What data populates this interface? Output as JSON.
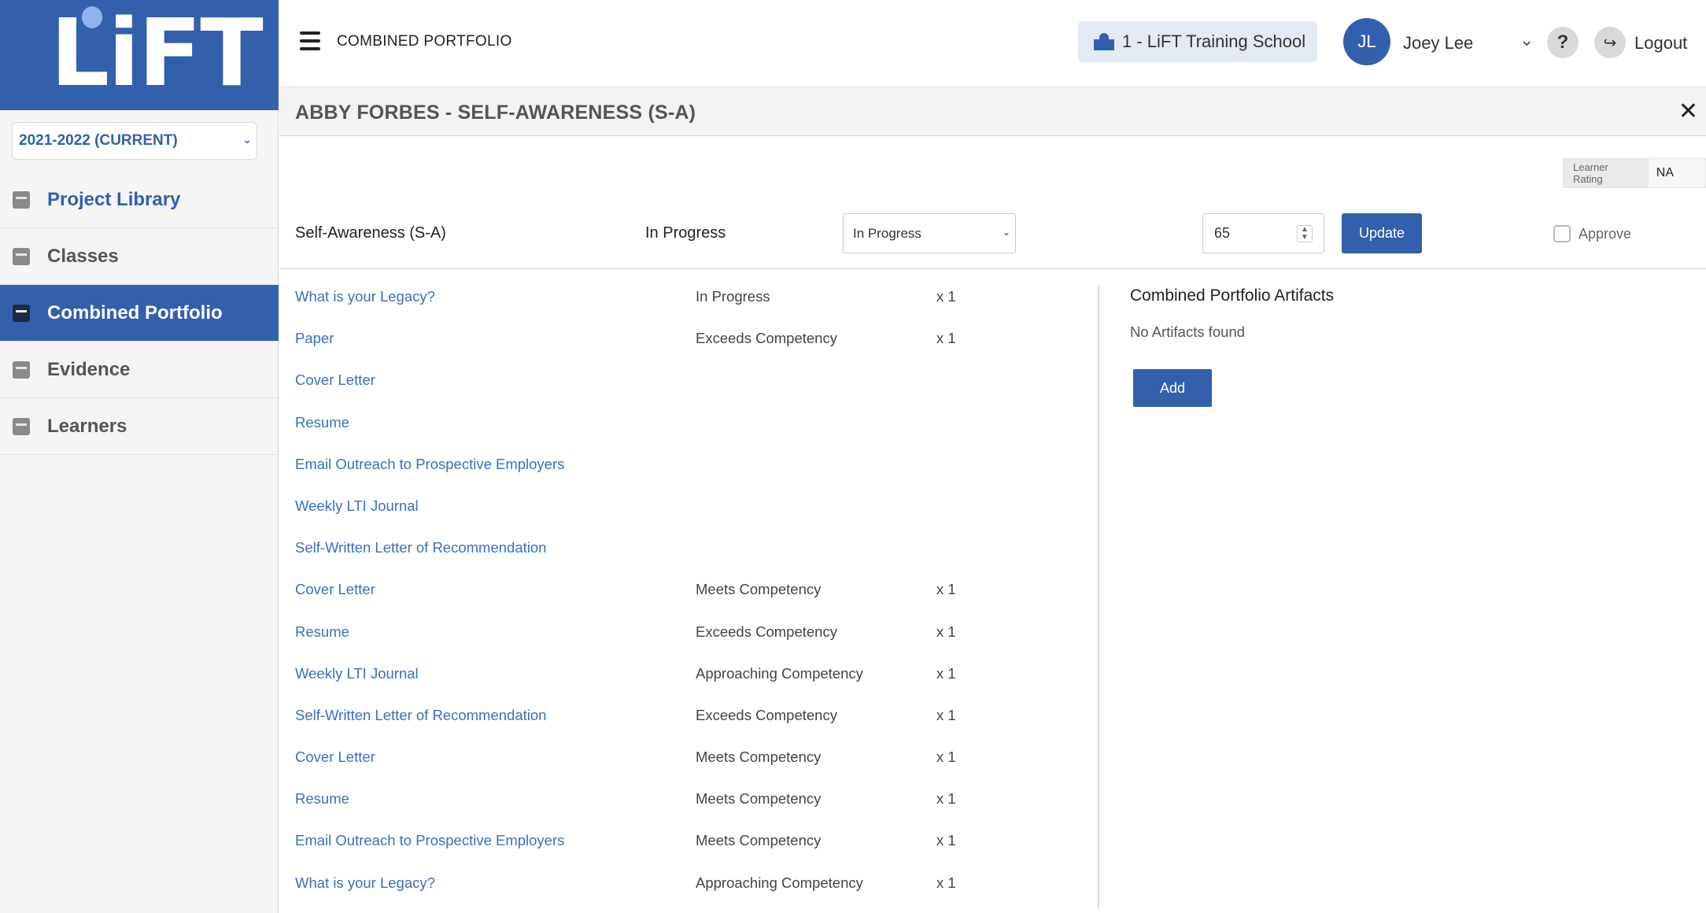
{
  "brand": {
    "logo_text": "LiFT"
  },
  "sidebar": {
    "year_select": "2021-2022 (CURRENT)",
    "items": [
      {
        "label": "Project Library",
        "icon": "book-icon"
      },
      {
        "label": "Classes",
        "icon": "open-book-icon"
      },
      {
        "label": "Combined Portfolio",
        "icon": "portfolio-icon",
        "active": true
      },
      {
        "label": "Evidence",
        "icon": "evidence-icon"
      },
      {
        "label": "Learners",
        "icon": "learners-icon"
      }
    ]
  },
  "topbar": {
    "title": "COMBINED PORTFOLIO",
    "school": "1 - LiFT Training School",
    "avatar_initials": "JL",
    "user_name": "Joey Lee",
    "help_label": "?",
    "logout_label": "Logout"
  },
  "panel": {
    "title": "ABBY FORBES - SELF-AWARENESS (S-A)",
    "learner_rating_label": "Learner Rating",
    "learner_rating_value": "NA",
    "competency_name": "Self-Awareness (S-A)",
    "competency_status": "In Progress",
    "status_select_value": "In Progress",
    "score_value": "65",
    "update_label": "Update",
    "approve_label": "Approve",
    "approve_checked": false
  },
  "evidence": [
    {
      "title": "What is your Legacy?",
      "rating": "In Progress",
      "count": "x 1"
    },
    {
      "title": "Paper",
      "rating": "Exceeds Competency",
      "count": "x 1"
    },
    {
      "title": "Cover Letter",
      "rating": "",
      "count": ""
    },
    {
      "title": "Resume",
      "rating": "",
      "count": ""
    },
    {
      "title": "Email Outreach to Prospective Employers",
      "rating": "",
      "count": ""
    },
    {
      "title": "Weekly LTI Journal",
      "rating": "",
      "count": ""
    },
    {
      "title": "Self-Written Letter of Recommendation",
      "rating": "",
      "count": ""
    },
    {
      "title": "Cover Letter",
      "rating": "Meets Competency",
      "count": "x 1"
    },
    {
      "title": "Resume",
      "rating": "Exceeds Competency",
      "count": "x 1"
    },
    {
      "title": "Weekly LTI Journal",
      "rating": "Approaching Competency",
      "count": "x 1"
    },
    {
      "title": "Self-Written Letter of Recommendation",
      "rating": "Exceeds Competency",
      "count": "x 1"
    },
    {
      "title": "Cover Letter",
      "rating": "Meets Competency",
      "count": "x 1"
    },
    {
      "title": "Resume",
      "rating": "Meets Competency",
      "count": "x 1"
    },
    {
      "title": "Email Outreach to Prospective Employers",
      "rating": "Meets Competency",
      "count": "x 1"
    },
    {
      "title": "What is your Legacy?",
      "rating": "Approaching Competency",
      "count": "x 1"
    }
  ],
  "artifacts": {
    "title": "Combined Portfolio Artifacts",
    "empty_text": "No Artifacts found",
    "add_label": "Add"
  },
  "colors": {
    "brand_blue": "#3260ad",
    "link_blue": "#3a6fc2"
  }
}
